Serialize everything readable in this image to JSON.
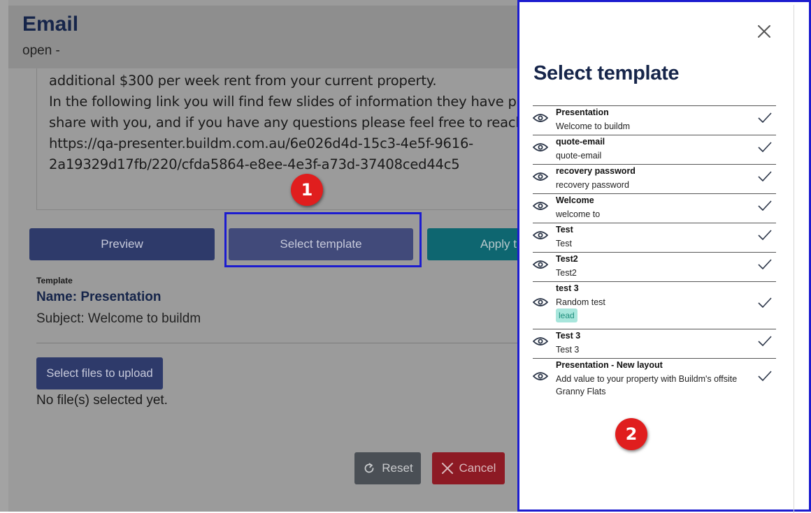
{
  "header": {
    "title": "Email",
    "status": "open -"
  },
  "message": {
    "lines": [
      "additional $300 per week rent from your current property.",
      "In the following link you will find few slides of information they have pro",
      "share with you, and if you have any questions please feel free to reach",
      "https://qa-presenter.buildm.com.au/6e026d4d-15c3-4e5f-9616-",
      "2a19329d17fb/220/cfda5864-e8ee-4e3f-a73d-37408ced44c5"
    ]
  },
  "buttons": {
    "preview": "Preview",
    "select_template": "Select template",
    "apply": "Apply t",
    "upload": "Select files to upload",
    "reset": "Reset",
    "cancel": "Cancel"
  },
  "template": {
    "caption": "Template",
    "name": "Name: Presentation",
    "subject": "Subject: Welcome to buildm"
  },
  "upload": {
    "status": "No file(s) selected yet."
  },
  "annotations": {
    "badge1": "1",
    "badge2": "2"
  },
  "panel": {
    "title": "Select template",
    "items": [
      {
        "name": "Presentation",
        "subject": "Welcome to buildm"
      },
      {
        "name": "quote-email",
        "subject": "quote-email"
      },
      {
        "name": "recovery password",
        "subject": "recovery password"
      },
      {
        "name": "Welcome",
        "subject": "welcome to"
      },
      {
        "name": "Test",
        "subject": "Test"
      },
      {
        "name": "Test2",
        "subject": "Test2"
      },
      {
        "name": "test 3",
        "subject": "Random test",
        "tag": "lead"
      },
      {
        "name": "Test 3",
        "subject": "Test 3"
      },
      {
        "name": "Presentation - New layout",
        "subject": "Add value to your property with Buildm's offsite Granny Flats"
      }
    ]
  },
  "icons": {
    "close": "close-icon",
    "view": "eye-icon",
    "select": "checkmark-icon",
    "reset": "reset-icon",
    "cancel": "x-icon"
  },
  "colors": {
    "primary": "#2e3a6a",
    "teal": "#0e6670",
    "danger": "#8d1a24",
    "highlight": "#1c1ccf",
    "badge": "#e01e1e",
    "title": "#16254a"
  }
}
